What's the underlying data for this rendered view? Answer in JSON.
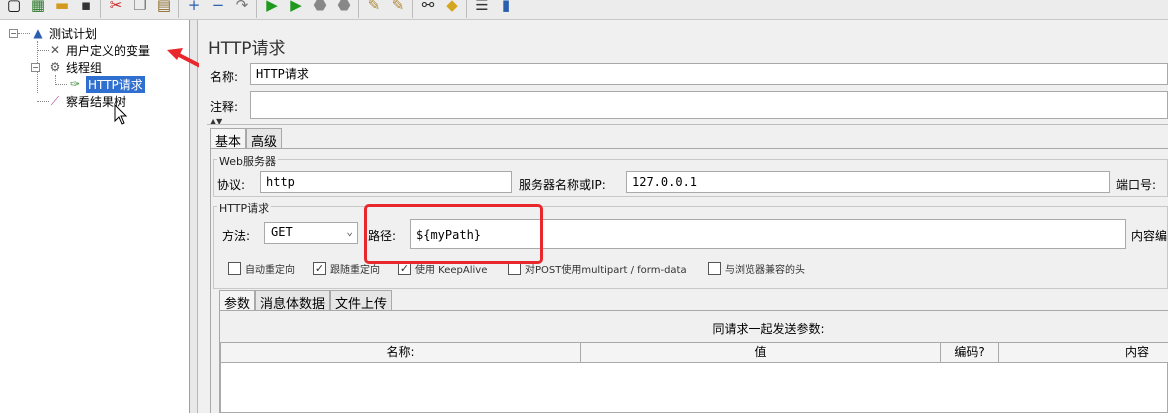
{
  "toolbar": {
    "icons": [
      "new-icon",
      "templates-icon",
      "open-icon",
      "save-icon",
      "cut-icon",
      "copy-icon",
      "paste-icon",
      "expand-icon",
      "collapse-icon",
      "toggle-icon",
      "start-icon",
      "start-no-pause-icon",
      "stop-icon",
      "shutdown-icon",
      "clear-icon",
      "clear-all-icon",
      "search-icon",
      "reset-search-icon",
      "function-helper-icon",
      "help-icon"
    ]
  },
  "tree": {
    "root": "测试计划",
    "variables": "用户定义的变量",
    "thread_group": "线程组",
    "http_request": "HTTP请求",
    "listener": "察看结果树"
  },
  "panel": {
    "title": "HTTP请求",
    "name_label": "名称:",
    "name_value": "HTTP请求",
    "comment_label": "注释:",
    "comment_value": "",
    "tabs": [
      "基本",
      "高级"
    ],
    "web_server": {
      "title": "Web服务器",
      "protocol_label": "协议:",
      "protocol_value": "http",
      "server_label": "服务器名称或IP:",
      "server_value": "127.0.0.1",
      "port_label": "端口号:"
    },
    "http_request": {
      "title": "HTTP请求",
      "method_label": "方法:",
      "method_value": "GET",
      "path_label": "路径:",
      "path_value": "${myPath}",
      "encoding_label": "内容编"
    },
    "checkboxes": [
      {
        "label": "自动重定向",
        "checked": false
      },
      {
        "label": "跟随重定向",
        "checked": true
      },
      {
        "label": "使用 KeepAlive",
        "checked": true
      },
      {
        "label": "对POST使用multipart / form-data",
        "checked": false
      },
      {
        "label": "与浏览器兼容的头",
        "checked": false
      }
    ],
    "sub_tabs": [
      "参数",
      "消息体数据",
      "文件上传"
    ],
    "params_caption": "同请求一起发送参数:",
    "columns": [
      "名称:",
      "值",
      "编码?",
      "内容"
    ]
  }
}
